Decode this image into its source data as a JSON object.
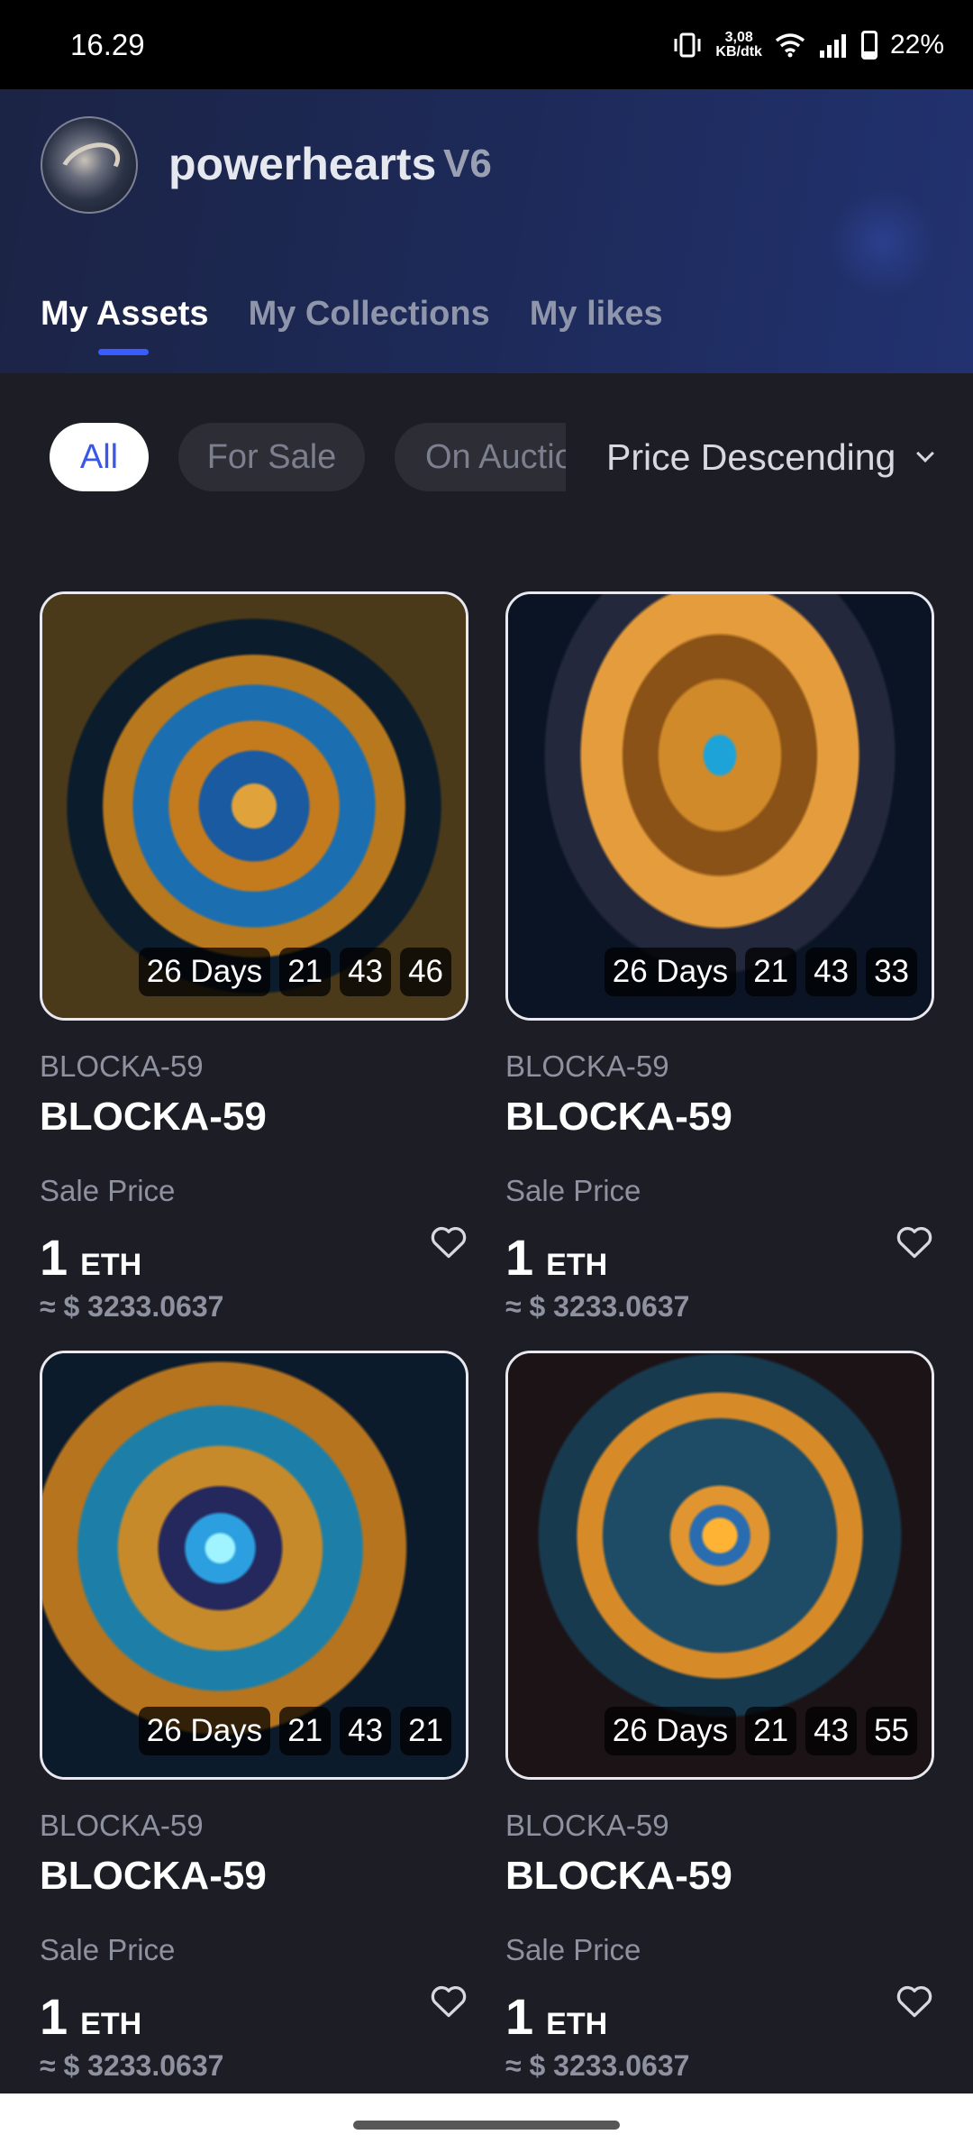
{
  "status_bar": {
    "time": "16.29",
    "net_speed_value": "3,08",
    "net_speed_unit": "KB/dtk",
    "battery": "22%",
    "battery_level": 0.22,
    "icons": [
      "vibrate-icon",
      "wifi-icon",
      "signal-icon",
      "battery-icon"
    ]
  },
  "profile": {
    "username": "powerhearts",
    "badge": "V6"
  },
  "tabs": [
    {
      "label": "My Assets",
      "active": true
    },
    {
      "label": "My Collections",
      "active": false
    },
    {
      "label": "My likes",
      "active": false
    }
  ],
  "filters": {
    "chips": [
      {
        "label": "All",
        "active": true
      },
      {
        "label": "For Sale",
        "active": false
      },
      {
        "label": "On Auction",
        "active": false
      }
    ],
    "sort_label": "Price Descending"
  },
  "assets": [
    {
      "collection": "BLOCKA-59",
      "title": "BLOCKA-59",
      "timer": {
        "days": "26 Days",
        "hours": "21",
        "minutes": "43",
        "seconds": "46"
      },
      "price_label": "Sale Price",
      "price": "1",
      "currency": "ETH",
      "usd": "≈ $ 3233.0637"
    },
    {
      "collection": "BLOCKA-59",
      "title": "BLOCKA-59",
      "timer": {
        "days": "26 Days",
        "hours": "21",
        "minutes": "43",
        "seconds": "33"
      },
      "price_label": "Sale Price",
      "price": "1",
      "currency": "ETH",
      "usd": "≈ $ 3233.0637"
    },
    {
      "collection": "BLOCKA-59",
      "title": "BLOCKA-59",
      "timer": {
        "days": "26 Days",
        "hours": "21",
        "minutes": "43",
        "seconds": "21"
      },
      "price_label": "Sale Price",
      "price": "1",
      "currency": "ETH",
      "usd": "≈ $ 3233.0637"
    },
    {
      "collection": "BLOCKA-59",
      "title": "BLOCKA-59",
      "timer": {
        "days": "26 Days",
        "hours": "21",
        "minutes": "43",
        "seconds": "55"
      },
      "price_label": "Sale Price",
      "price": "1",
      "currency": "ETH",
      "usd": "≈ $ 3233.0637"
    }
  ],
  "colors": {
    "accent": "#3a5bff",
    "background": "#1d1e25",
    "header": "#1d2a5a"
  }
}
